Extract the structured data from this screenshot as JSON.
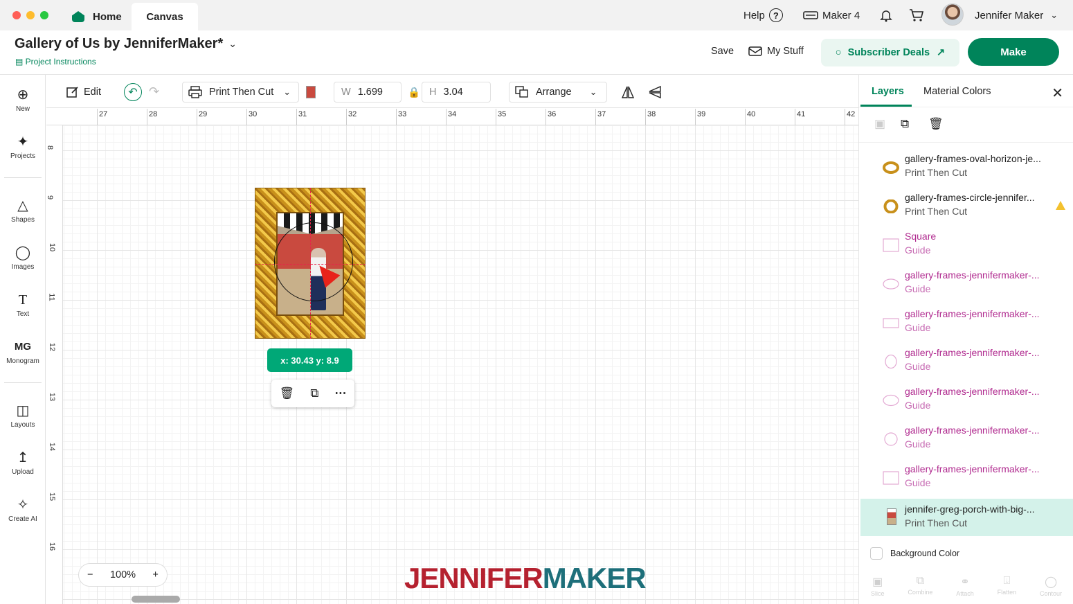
{
  "window": {
    "tabs": [
      {
        "label": "Home"
      },
      {
        "label": "Canvas"
      }
    ],
    "help_label": "Help",
    "help_symbol": "?",
    "device_label": "Maker 4",
    "user_name": "Jennifer Maker"
  },
  "header": {
    "project_title": "Gallery of Us by JenniferMaker*",
    "project_instructions": "Project Instructions",
    "save_label": "Save",
    "my_stuff_label": "My Stuff",
    "subscriber_deals_label": "Subscriber Deals",
    "make_label": "Make"
  },
  "sidebar": {
    "items": [
      {
        "label": "New",
        "icon": "plus-circle-icon"
      },
      {
        "label": "Projects",
        "icon": "rocket-icon"
      },
      {
        "label": "Shapes",
        "icon": "shapes-icon"
      },
      {
        "label": "Images",
        "icon": "lightbulb-icon"
      },
      {
        "label": "Text",
        "icon": "text-icon"
      },
      {
        "label": "Monogram",
        "icon": "monogram-icon"
      },
      {
        "label": "Layouts",
        "icon": "shirt-icon"
      },
      {
        "label": "Upload",
        "icon": "upload-icon"
      },
      {
        "label": "Create AI",
        "icon": "sparkle-icon"
      }
    ]
  },
  "toolbar": {
    "edit_label": "Edit",
    "operation_label": "Print Then Cut",
    "width_label": "W",
    "width_value": "1.699",
    "height_label": "H",
    "height_value": "3.04",
    "arrange_label": "Arrange"
  },
  "canvas": {
    "ruler_top": [
      "27",
      "28",
      "29",
      "30",
      "31",
      "32",
      "33",
      "34",
      "35",
      "36",
      "37",
      "38",
      "39",
      "40",
      "41",
      "42"
    ],
    "ruler_left": [
      "8",
      "9",
      "10",
      "11",
      "12",
      "13",
      "14",
      "15",
      "16"
    ],
    "coord_badge": "x: 30.43 y: 8.9",
    "zoom_level": "100%",
    "zoom_minus": "−",
    "zoom_plus": "+",
    "brand_part1": "JENNIFER",
    "brand_part2": "MAKER"
  },
  "panel": {
    "tab_layers": "Layers",
    "tab_material_colors": "Material Colors",
    "layers": [
      {
        "name": "gallery-frames-oval-horizon-je...",
        "type": "Print Then Cut",
        "thumb": "oval-frame"
      },
      {
        "name": "gallery-frames-circle-jennifer...",
        "type": "Print Then Cut",
        "thumb": "circle-frame",
        "warning": true
      },
      {
        "name": "Square",
        "type": "Guide",
        "thumb": "square"
      },
      {
        "name": "gallery-frames-jennifermaker-...",
        "type": "Guide",
        "thumb": "oval-h"
      },
      {
        "name": "gallery-frames-jennifermaker-...",
        "type": "Guide",
        "thumb": "rect-h"
      },
      {
        "name": "gallery-frames-jennifermaker-...",
        "type": "Guide",
        "thumb": "oval-v"
      },
      {
        "name": "gallery-frames-jennifermaker-...",
        "type": "Guide",
        "thumb": "oval-h"
      },
      {
        "name": "gallery-frames-jennifermaker-...",
        "type": "Guide",
        "thumb": "circle"
      },
      {
        "name": "gallery-frames-jennifermaker-...",
        "type": "Guide",
        "thumb": "square"
      },
      {
        "name": "jennifer-greg-porch-with-big-...",
        "type": "Print Then Cut",
        "thumb": "photo",
        "selected": true
      }
    ],
    "background_color_label": "Background Color",
    "bottom_tools": [
      {
        "label": "Slice"
      },
      {
        "label": "Combine"
      },
      {
        "label": "Attach"
      },
      {
        "label": "Flatten"
      },
      {
        "label": "Contour"
      }
    ]
  },
  "colors": {
    "accent": "#00845a",
    "guide_text": "#b02a8f",
    "selected_layer_bg": "#d4f2ea",
    "coord_badge_bg": "#00a877"
  }
}
